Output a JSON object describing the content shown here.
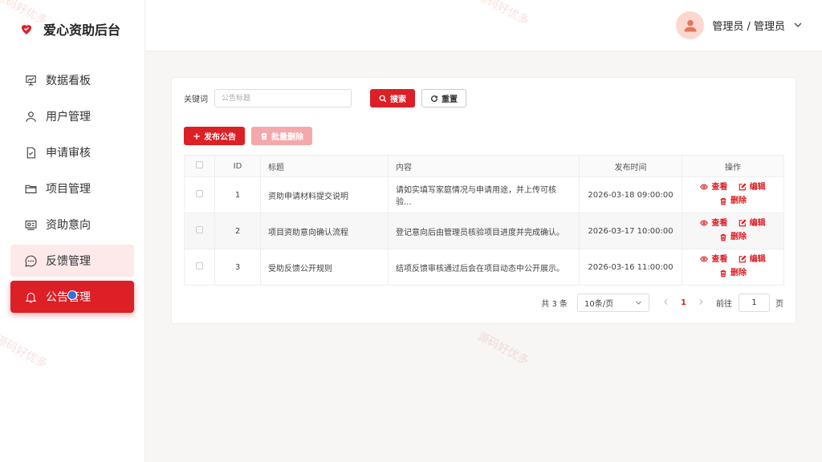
{
  "brand": {
    "title": "爱心资助后台"
  },
  "menu": [
    {
      "label": "数据看板",
      "icon": "presentation-chart-icon"
    },
    {
      "label": "用户管理",
      "icon": "user-icon"
    },
    {
      "label": "申请审核",
      "icon": "file-check-icon"
    },
    {
      "label": "项目管理",
      "icon": "folder-icon"
    },
    {
      "label": "资助意向",
      "icon": "id-card-icon"
    },
    {
      "label": "反馈管理",
      "icon": "chat-icon"
    },
    {
      "label": "公告管理",
      "icon": "bell-icon"
    }
  ],
  "header": {
    "user_name": "管理员 / 管理员"
  },
  "search": {
    "label": "关键词",
    "placeholder": "公告标题",
    "search_label": "搜索",
    "reset_label": "重置"
  },
  "actions": {
    "add_label": "发布公告",
    "batch_delete_label": "批量删除"
  },
  "table": {
    "headers": {
      "id": "ID",
      "title": "标题",
      "content": "内容",
      "time": "发布时间",
      "ops": "操作"
    },
    "rows": [
      {
        "id": "1",
        "title": "资助申请材料提交说明",
        "content": "请如实填写家庭情况与申请用途，并上传可核验...",
        "time": "2026-03-18 09:00:00"
      },
      {
        "id": "2",
        "title": "项目资助意向确认流程",
        "content": "登记意向后由管理员核验项目进度并完成确认。",
        "time": "2026-03-17 10:00:00"
      },
      {
        "id": "3",
        "title": "受助反馈公开规则",
        "content": "结项反馈审核通过后会在项目动态中公开展示。",
        "time": "2026-03-16 11:00:00"
      }
    ],
    "op_view": "查看",
    "op_edit": "编辑",
    "op_delete": "删除"
  },
  "pager": {
    "total": "共 3 条",
    "page_size": "10条/页",
    "current_page": "1",
    "goto_label": "前往",
    "goto_value": "1",
    "page_unit": "页"
  },
  "watermark": "源码好优多",
  "colors": {
    "accent": "#dd1f26",
    "menu_hover": "#fde9e9"
  }
}
